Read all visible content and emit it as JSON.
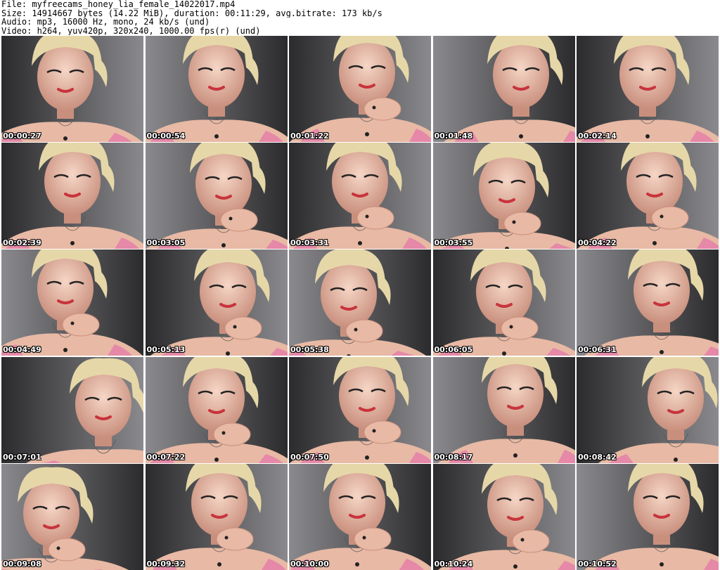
{
  "header": {
    "file_line": "File: myfreecams_honey_lia_female_14022017.mp4",
    "size_line": "Size: 14914667 bytes (14.22 MiB), duration: 00:11:29, avg.bitrate: 173 kb/s",
    "audio_line": "Audio: mp3, 16000 Hz, mono, 24 kb/s (und)",
    "video_line": "Video: h264, yuv420p, 320x240, 1000.00 fps(r) (und)"
  },
  "thumbnails": [
    {
      "time": "00:00:27"
    },
    {
      "time": "00:00:54"
    },
    {
      "time": "00:01:22"
    },
    {
      "time": "00:01:48"
    },
    {
      "time": "00:02:14"
    },
    {
      "time": "00:02:39"
    },
    {
      "time": "00:03:05"
    },
    {
      "time": "00:03:31"
    },
    {
      "time": "00:03:55"
    },
    {
      "time": "00:04:22"
    },
    {
      "time": "00:04:49"
    },
    {
      "time": "00:05:13"
    },
    {
      "time": "00:05:38"
    },
    {
      "time": "00:06:05"
    },
    {
      "time": "00:06:31"
    },
    {
      "time": "00:07:01"
    },
    {
      "time": "00:07:22"
    },
    {
      "time": "00:07:50"
    },
    {
      "time": "00:08:17"
    },
    {
      "time": "00:08:42"
    },
    {
      "time": "00:09:08"
    },
    {
      "time": "00:09:32"
    },
    {
      "time": "00:10:00"
    },
    {
      "time": "00:10:24"
    },
    {
      "time": "00:10:52"
    }
  ],
  "colors": {
    "skin": "#e8b9a4",
    "skin_shadow": "#c98f7d",
    "hair": "#e6d7a8",
    "background_dark": "#2b2b2d",
    "background_light": "#8a8a8e",
    "top_pink": "#e57fa8",
    "lips": "#c8343c",
    "timestamp_text": "#ffffff"
  }
}
